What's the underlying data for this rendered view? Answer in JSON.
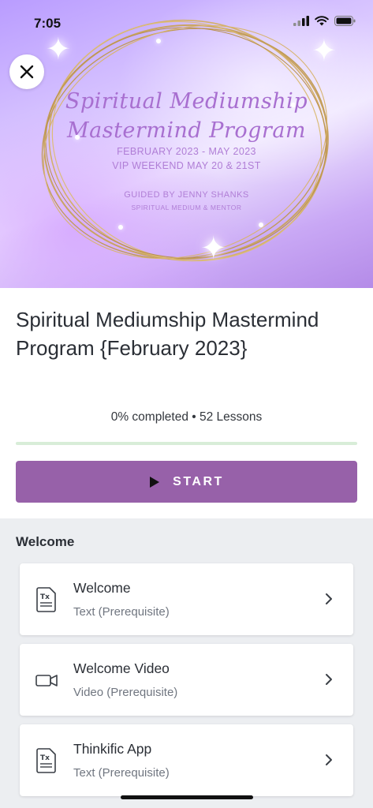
{
  "status_bar": {
    "time": "7:05"
  },
  "hero": {
    "title_line1": "Spiritual Mediumship",
    "title_line2": "Mastermind Program",
    "dates": "FEBRUARY 2023 - MAY 2023",
    "vip": "VIP WEEKEND MAY 20 & 21ST",
    "guided": "GUIDED BY JENNY SHANKS",
    "mentor": "SPIRITUAL MEDIUM & MENTOR"
  },
  "course": {
    "title": "Spiritual Mediumship Mastermind Program {February 2023}",
    "meta": "0% completed • 52 Lessons",
    "progress_fraction": 0.0,
    "start_label": "START"
  },
  "section": {
    "title": "Welcome"
  },
  "lessons": [
    {
      "title": "Welcome",
      "subtitle": "Text (Prerequisite)",
      "icon": "text-document-icon"
    },
    {
      "title": "Welcome Video",
      "subtitle": "Video (Prerequisite)",
      "icon": "video-camera-icon"
    },
    {
      "title": "Thinkific App",
      "subtitle": "Text (Prerequisite)",
      "icon": "text-document-icon"
    }
  ],
  "colors": {
    "accent": "#9761a9",
    "progress_track": "#d8edd8",
    "hero_text": "#a86fd0",
    "ring_gold": "#c9a463"
  }
}
